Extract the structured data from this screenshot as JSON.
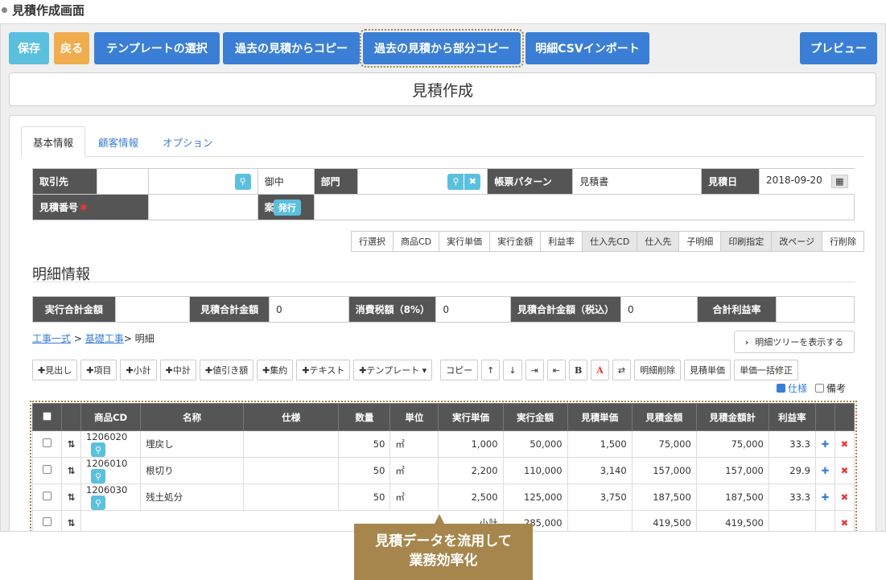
{
  "caption": "見積作成画面",
  "toolbar": {
    "save": "保存",
    "back": "戻る",
    "template_select": "テンプレートの選択",
    "copy_past": "過去の見積からコピー",
    "copy_partial": "過去の見積から部分コピー",
    "csv_import": "明細CSVインポート",
    "preview": "プレビュー"
  },
  "page_title": "見積作成",
  "tabs": [
    "基本情報",
    "顧客情報",
    "オプション"
  ],
  "form": {
    "client_label": "取引先",
    "client_suffix": "御中",
    "dept_label": "部門",
    "format_label": "帳票パターン",
    "format_value": "見積書",
    "date_label": "見積日",
    "date_value": "2018-09-20",
    "number_label": "見積番号",
    "required_mark": "✱",
    "issue_button": "発行",
    "project_label": "案件名"
  },
  "column_toggles": [
    "行選択",
    "商品CD",
    "実行単価",
    "実行金額",
    "利益率",
    "仕入先CD",
    "仕入先",
    "子明細",
    "印刷指定",
    "改ページ",
    "行削除"
  ],
  "section_title": "明細情報",
  "totals": {
    "exec_total_label": "実行合計金額",
    "exec_total_value": "",
    "est_total_label": "見積合計金額",
    "est_total_value": "0",
    "tax_label": "消費税額（8%）",
    "tax_value": "0",
    "est_total_tax_label": "見積合計金額（税込）",
    "est_total_tax_value": "0",
    "profit_label": "合計利益率",
    "profit_value": ""
  },
  "breadcrumb": {
    "level1": "工事一式",
    "level2": "基礎工事",
    "current": "明細",
    "sep": ">"
  },
  "tree_button": "明細ツリーを表示する",
  "tools": [
    "✚見出し",
    "✚項目",
    "✚小計",
    "✚中計",
    "✚値引き額",
    "✚集約",
    "✚テキスト",
    "✚テンプレート ▾",
    "コピー",
    "↑",
    "↓",
    "⇥",
    "⇤",
    "B",
    "A",
    "⇄",
    "明細削除",
    "見積単価",
    "単価一括修正"
  ],
  "checks": {
    "spec": "仕様",
    "note": "備考"
  },
  "grid": {
    "headers": [
      "",
      "",
      "商品CD",
      "名称",
      "仕様",
      "数量",
      "単位",
      "実行単価",
      "実行金額",
      "見積単価",
      "見積金額",
      "見積金額計",
      "利益率",
      "",
      ""
    ],
    "rows": [
      {
        "code": "1206020",
        "name": "埋戻し",
        "qty": "50",
        "unit": "㎡",
        "exec_price": "1,000",
        "exec_amount": "50,000",
        "est_price": "1,500",
        "est_amount": "75,000",
        "est_sum": "75,000",
        "rate": "33.3"
      },
      {
        "code": "1206010",
        "name": "根切り",
        "qty": "50",
        "unit": "㎡",
        "exec_price": "2,200",
        "exec_amount": "110,000",
        "est_price": "3,140",
        "est_amount": "157,000",
        "est_sum": "157,000",
        "rate": "29.9"
      },
      {
        "code": "1206030",
        "name": "残土処分",
        "qty": "50",
        "unit": "㎡",
        "exec_price": "2,500",
        "exec_amount": "125,000",
        "est_price": "3,750",
        "est_amount": "187,500",
        "est_sum": "187,500",
        "rate": "33.3"
      }
    ],
    "subtotal": {
      "label": "小計",
      "exec_amount": "285,000",
      "est_amount": "419,500",
      "est_sum": "419,500"
    }
  },
  "callout": {
    "line1": "見積データを流用して",
    "line2": "業務効率化"
  },
  "colors": {
    "accent_blue": "#3a7fd5",
    "teal": "#5bc0de",
    "orange": "#f0ad4e",
    "label_bg": "#555555",
    "callout": "#a6864c",
    "delete_red": "#e53935"
  }
}
